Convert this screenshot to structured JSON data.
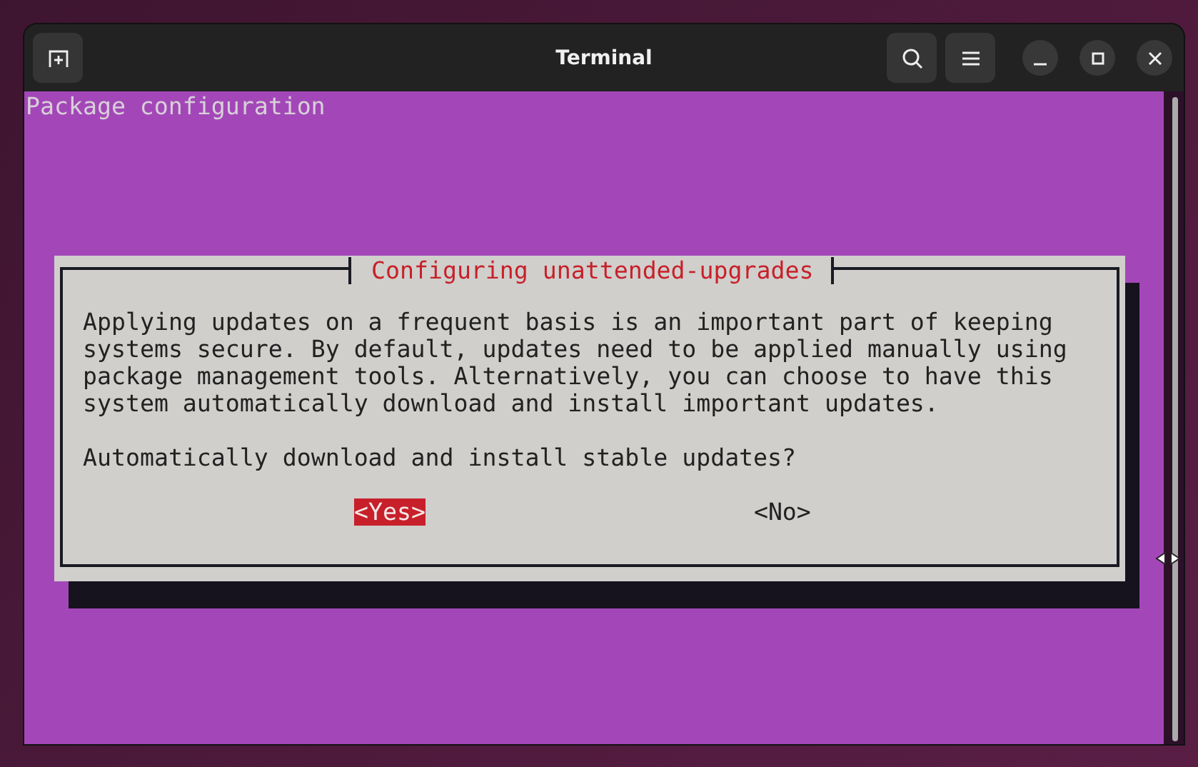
{
  "window": {
    "title": "Terminal"
  },
  "terminal": {
    "header": "Package configuration"
  },
  "dialog": {
    "title": "Configuring unattended-upgrades",
    "message": "Applying updates on a frequent basis is an important part of keeping\nsystems secure. By default, updates need to be applied manually using\npackage management tools. Alternatively, you can choose to have this\nsystem automatically download and install important updates.",
    "question": "Automatically download and install stable updates?",
    "buttons": [
      {
        "label": "<Yes>",
        "selected": true
      },
      {
        "label": "<No>",
        "selected": false
      }
    ]
  }
}
